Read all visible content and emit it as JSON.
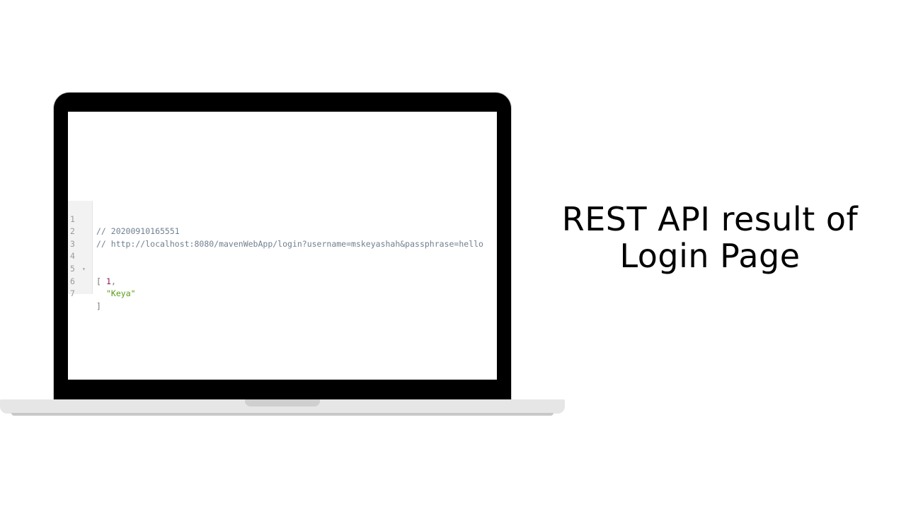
{
  "slide": {
    "title_line1": "REST API result of",
    "title_line2": "Login Page"
  },
  "code_viewer": {
    "lines": [
      {
        "number": "1",
        "text": "// 20200910165551"
      },
      {
        "number": "2",
        "text": "// http://localhost:8080/mavenWebApp/login?username=mskeyashah&passphrase=hello"
      },
      {
        "number": "3",
        "text": ""
      },
      {
        "number": "4",
        "text": "["
      },
      {
        "number": "5",
        "value": "1",
        "suffix": ","
      },
      {
        "number": "6",
        "value": "\"Keya\""
      },
      {
        "number": "7",
        "text": "]"
      }
    ],
    "fold_marker": "▾"
  },
  "colors": {
    "comment": "#708090",
    "number": "#8a1a5c",
    "string": "#5a9a1a",
    "laptop_bezel": "#000000",
    "laptop_base": "#e6e6e6"
  }
}
